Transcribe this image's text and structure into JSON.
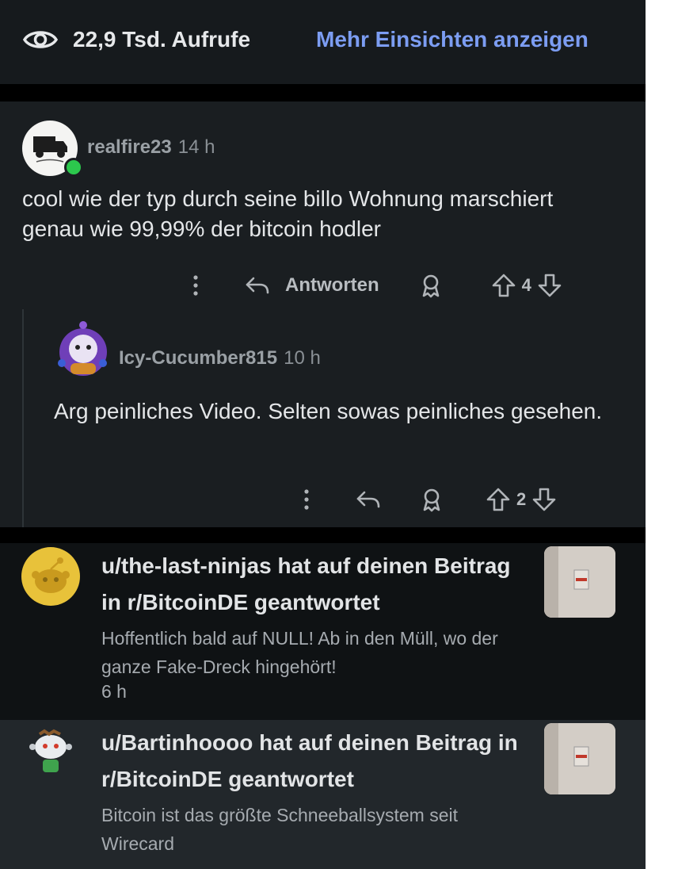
{
  "insights": {
    "views_icon": "eye-icon",
    "views": "22,9 Tsd. Aufrufe",
    "link": "Mehr Einsichten anzeigen"
  },
  "comment": {
    "username": "realfire23",
    "time": "14 h",
    "text": "cool wie der typ durch seine billo Wohnung marschiert genau wie 99,99% der bitcoin hodler",
    "reply_label": "Antworten",
    "votes": "4",
    "icons": [
      "more-vertical-icon",
      "reply-icon",
      "award-icon",
      "upvote-icon",
      "downvote-icon"
    ]
  },
  "reply": {
    "username": "Icy-Cucumber815",
    "time": "10 h",
    "text": "Arg peinliches Video. Selten sowas peinliches gesehen.",
    "votes": "2"
  },
  "notifications": [
    {
      "title": "u/the-last-ninjas hat auf deinen Beitrag in r/BitcoinDE geantwortet",
      "text": "Hoffentlich bald auf NULL! Ab in den Müll, wo der ganze Fake-Dreck hingehört!",
      "time": "6 h"
    },
    {
      "title": "u/Bartinhoooo hat auf deinen Beitrag in r/BitcoinDE geantwortet",
      "text": "Bitcoin ist das größte Schneeballsystem seit Wirecard"
    }
  ],
  "colors": {
    "background": "#0b0c0e",
    "card": "#1a1e21",
    "link": "#7c9df2",
    "online": "#2cc84d"
  }
}
